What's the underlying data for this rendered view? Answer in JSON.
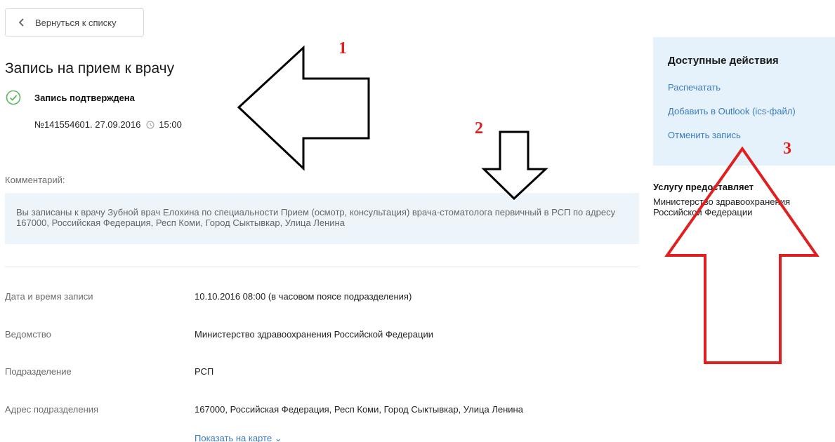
{
  "back_button": {
    "label": "Вернуться к списку"
  },
  "title": "Запись на прием к врачу",
  "status": {
    "text": "Запись подтверждена",
    "icon": "check-circle-icon",
    "color": "#5cb85c"
  },
  "record": {
    "number_date": "№141554601. 27.09.2016",
    "time": "15:00"
  },
  "comment": {
    "label": "Комментарий:",
    "text": "Вы записаны к врачу Зубной врач Елохина по специальности Прием (осмотр, консультация) врача-стоматолога первичный в РСП по адресу 167000, Российская Федерация, Респ Коми, Город Сыктывкар, Улица Ленина"
  },
  "details": [
    {
      "label": "Дата и время записи",
      "value": "10.10.2016 08:00 (в часовом поясе подразделения)"
    },
    {
      "label": "Ведомство",
      "value": "Министерство здравоохранения Российской Федерации"
    },
    {
      "label": "Подразделение",
      "value": "РСП"
    },
    {
      "label": "Адрес подразделения",
      "value": "167000, Российская Федерация, Респ Коми, Город Сыктывкар, Улица Ленина"
    }
  ],
  "map_link": "Показать на карте ⌄",
  "actions": {
    "title": "Доступные действия",
    "items": [
      "Распечатать",
      "Добавить в Outlook (ics-файл)",
      "Отменить запись"
    ]
  },
  "provider": {
    "title": "Услугу предоставляет",
    "name": "Министерство здравоохранения Российской Федерации"
  },
  "annotations": {
    "numbers": [
      "1",
      "2",
      "3"
    ],
    "colors": {
      "black": "#000000",
      "red": "#e02020"
    }
  },
  "colors": {
    "link": "#3a7bbf",
    "panel_bg": "#e6f2fb",
    "comment_bg": "#eef5fa"
  }
}
